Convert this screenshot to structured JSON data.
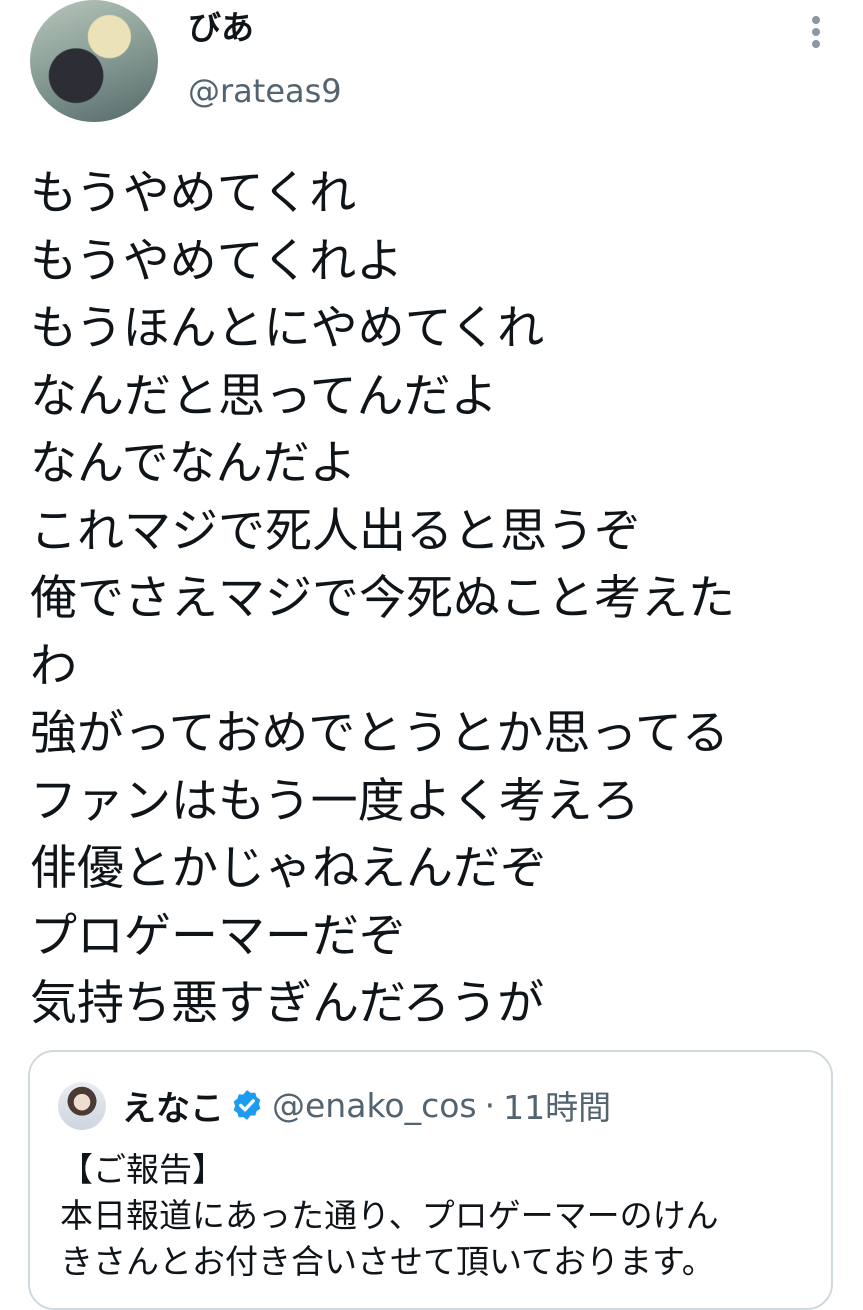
{
  "author": {
    "display_name": "びあ",
    "handle": "@rateas9"
  },
  "more_icon": "more-vertical-icon",
  "tweet": {
    "lines": [
      "もうやめてくれ",
      "もうやめてくれよ",
      "もうほんとにやめてくれ",
      "なんだと思ってんだよ",
      "なんでなんだよ",
      "これマジで死人出ると思うぞ",
      "俺でさえマジで今死ぬこと考えた",
      "わ",
      "強がっておめでとうとか思ってる",
      "ファンはもう一度よく考えろ",
      "俳優とかじゃねえんだぞ",
      "プロゲーマーだぞ",
      "気持ち悪すぎんだろうが"
    ]
  },
  "quote": {
    "display_name": "えなこ",
    "verified_icon": "verified-badge-icon",
    "handle": "@enako_cos",
    "separator": "·",
    "time": "11時間",
    "lines": [
      "【ご報告】",
      "本日報道にあった通り、プロゲーマーのけん",
      "きさんとお付き合いさせて頂いております。"
    ]
  },
  "colors": {
    "text": "#0f1419",
    "secondary_text": "#536471",
    "verified": "#1d9bf0",
    "border": "#cfd9de"
  }
}
